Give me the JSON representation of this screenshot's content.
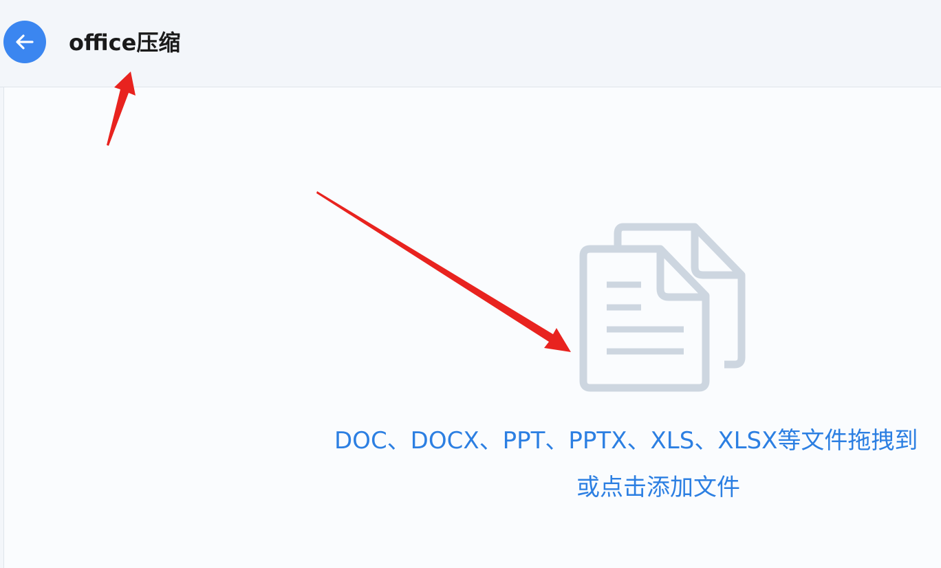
{
  "header": {
    "back_icon": "arrow-left-icon",
    "title": "office压缩"
  },
  "dropzone": {
    "icon": "documents-icon",
    "hint": "DOC、DOCX、PPT、PPTX、XLS、XLSX等文件拖拽到",
    "add_link": "或点击添加文件"
  },
  "colors": {
    "accent": "#3b86f0",
    "link": "#2c7fe2",
    "icon": "#cdd6e0",
    "annotation_arrow": "#e8231f"
  }
}
